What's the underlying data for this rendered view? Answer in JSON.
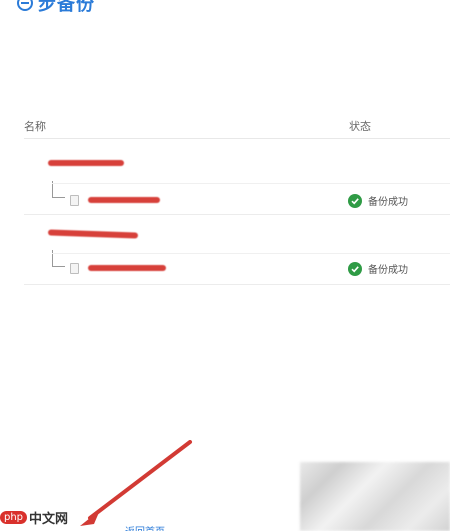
{
  "app": {
    "title": "步备份",
    "brand_color": "#2b7bd8"
  },
  "table": {
    "col_name": "名称",
    "col_status": "状态",
    "rows": [
      {
        "status_text": "备份成功"
      },
      {
        "status_text": "备份成功"
      }
    ]
  },
  "footer": {
    "watermark_badge": "php",
    "watermark_text": "中文网",
    "link_text": "返回首页"
  },
  "colors": {
    "redaction": "#d7403a",
    "success": "#2f9b45",
    "arrow": "#d23a34"
  },
  "icons": [
    "brand-logo-icon",
    "file-icon",
    "check-icon",
    "pointer-arrow-icon"
  ]
}
